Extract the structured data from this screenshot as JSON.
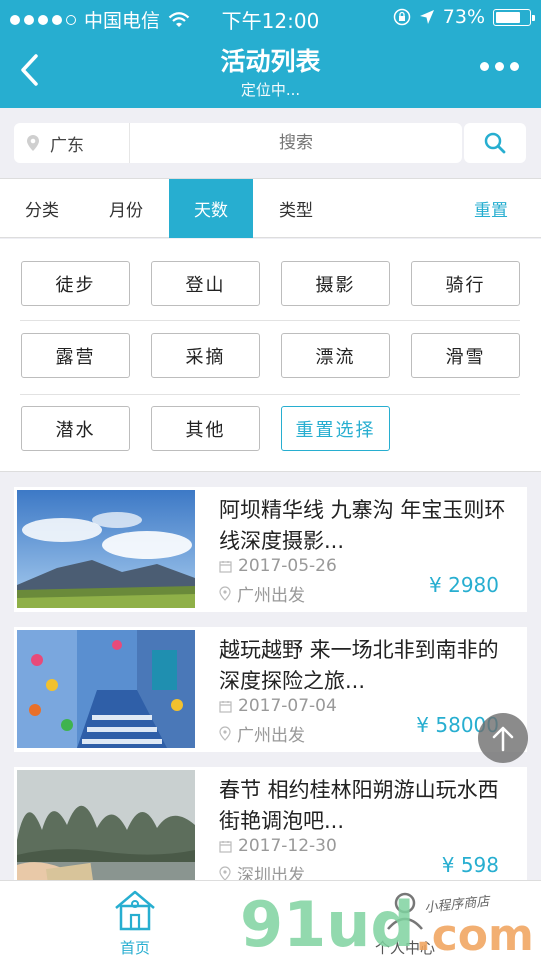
{
  "status": {
    "carrier": "中国电信",
    "time": "下午12:00",
    "battery": "73%",
    "battery_level": 0.73,
    "signal_bars": 4
  },
  "nav": {
    "title": "活动列表",
    "subtitle": "定位中..."
  },
  "search": {
    "location": "广东",
    "placeholder": "搜索"
  },
  "tabs": [
    "分类",
    "月份",
    "天数",
    "类型",
    "重置"
  ],
  "active_tab": "天数",
  "options": [
    [
      "徒步",
      "登山",
      "摄影",
      "骑行"
    ],
    [
      "露营",
      "采摘",
      "漂流",
      "滑雪"
    ],
    [
      "潜水",
      "其他",
      "重置选择"
    ]
  ],
  "activities": [
    {
      "title": "阿坝精华线 九寨沟 年宝玉则环线深度摄影...",
      "date": "2017-05-26",
      "place": "广州出发",
      "price": "¥ 2980"
    },
    {
      "title": "越玩越野 来一场北非到南非的深度探险之旅...",
      "date": "2017-07-04",
      "place": "广州出发",
      "price": "¥ 58000"
    },
    {
      "title": "春节 相约桂林阳朔游山玩水西街艳调泡吧...",
      "date": "2017-12-30",
      "place": "深圳出发",
      "price": "¥ 598"
    }
  ],
  "bottom_nav": {
    "home": "首页",
    "profile": "个人中心"
  },
  "watermark": {
    "brand": "91ud",
    "suffix": ".com",
    "tagline": "小程序商店"
  },
  "colors": {
    "accent": "#27aed0",
    "background": "#efeff4"
  }
}
